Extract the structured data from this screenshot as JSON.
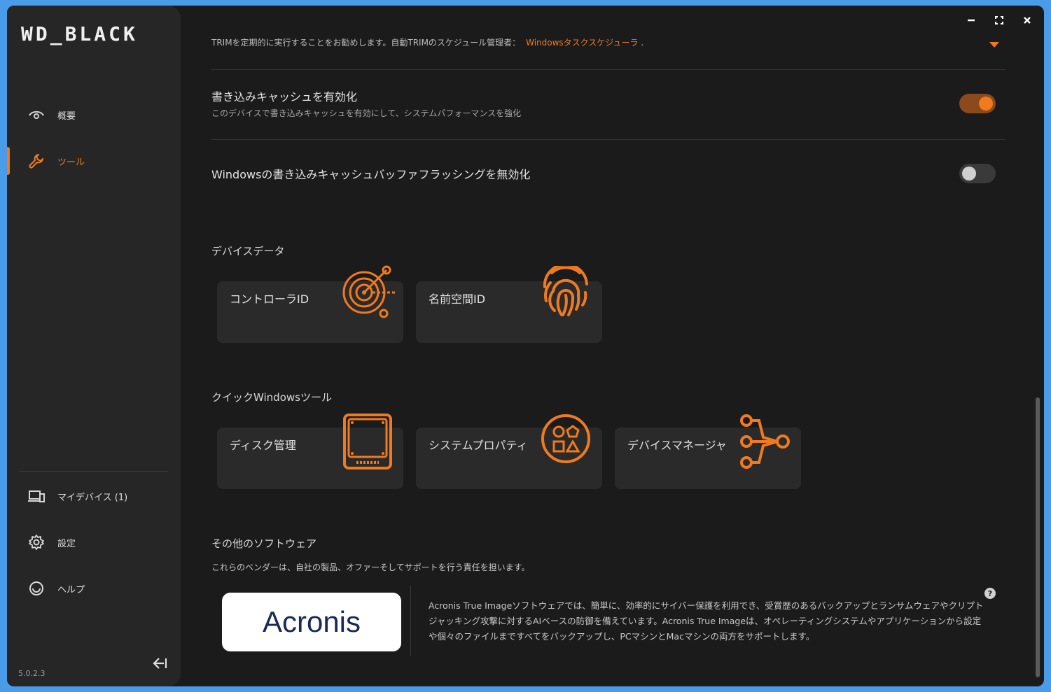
{
  "app": {
    "logo": "WD_BLACK",
    "version": "5.0.2.3"
  },
  "colors": {
    "accent": "#f07a20",
    "background": "#1b1b1b",
    "sidebar": "#262626"
  },
  "sidebar": {
    "items": [
      {
        "label": "概要",
        "icon": "eye-icon"
      },
      {
        "label": "ツール",
        "icon": "wrench-icon",
        "active": true
      }
    ],
    "bottom_items": [
      {
        "label": "マイデバイス (1)",
        "icon": "devices-icon"
      },
      {
        "label": "設定",
        "icon": "gear-icon"
      },
      {
        "label": "ヘルプ",
        "icon": "help-face-icon"
      }
    ]
  },
  "trim": {
    "text": "TRIMを定期的に実行することをお勧めします。自動TRIMのスケジュール管理者：",
    "link": "Windowsタスクスケジューラ",
    "suffix": " ."
  },
  "settings": [
    {
      "title": "書き込みキャッシュを有効化",
      "desc": "このデバイスで書き込みキャッシュを有効にして、システムパフォーマンスを強化",
      "enabled": true
    },
    {
      "title": "Windowsの書き込みキャッシュバッファフラッシングを無効化",
      "desc": "",
      "enabled": false
    }
  ],
  "device_data": {
    "heading": "デバイスデータ",
    "cards": [
      {
        "label": "コントローラID",
        "icon": "target-network-icon"
      },
      {
        "label": "名前空間ID",
        "icon": "fingerprint-icon"
      }
    ]
  },
  "quick_tools": {
    "heading": "クイックWindowsツール",
    "cards": [
      {
        "label": "ディスク管理",
        "icon": "disk-drive-icon"
      },
      {
        "label": "システムプロパティ",
        "icon": "shapes-icon"
      },
      {
        "label": "デバイスマネージャ",
        "icon": "device-tree-icon"
      }
    ]
  },
  "other_software": {
    "heading": "その他のソフトウェア",
    "desc": "これらのベンダーは、自社の製品、オファーそしてサポートを行う責任を担います。",
    "vendor_logo": "Acronis",
    "vendor_desc": "Acronis True Imageソフトウェアでは、簡単に、効率的にサイバー保護を利用でき、受賞歴のあるバックアップとランサムウェアやクリプトジャッキング攻撃に対するAIベースの防御を備えています。Acronis True Imageは、オペレーティングシステムやアプリケーションから設定や個々のファイルまですべてをバックアップし、PCマシンとMacマシンの両方をサポートします。",
    "help_glyph": "?"
  }
}
